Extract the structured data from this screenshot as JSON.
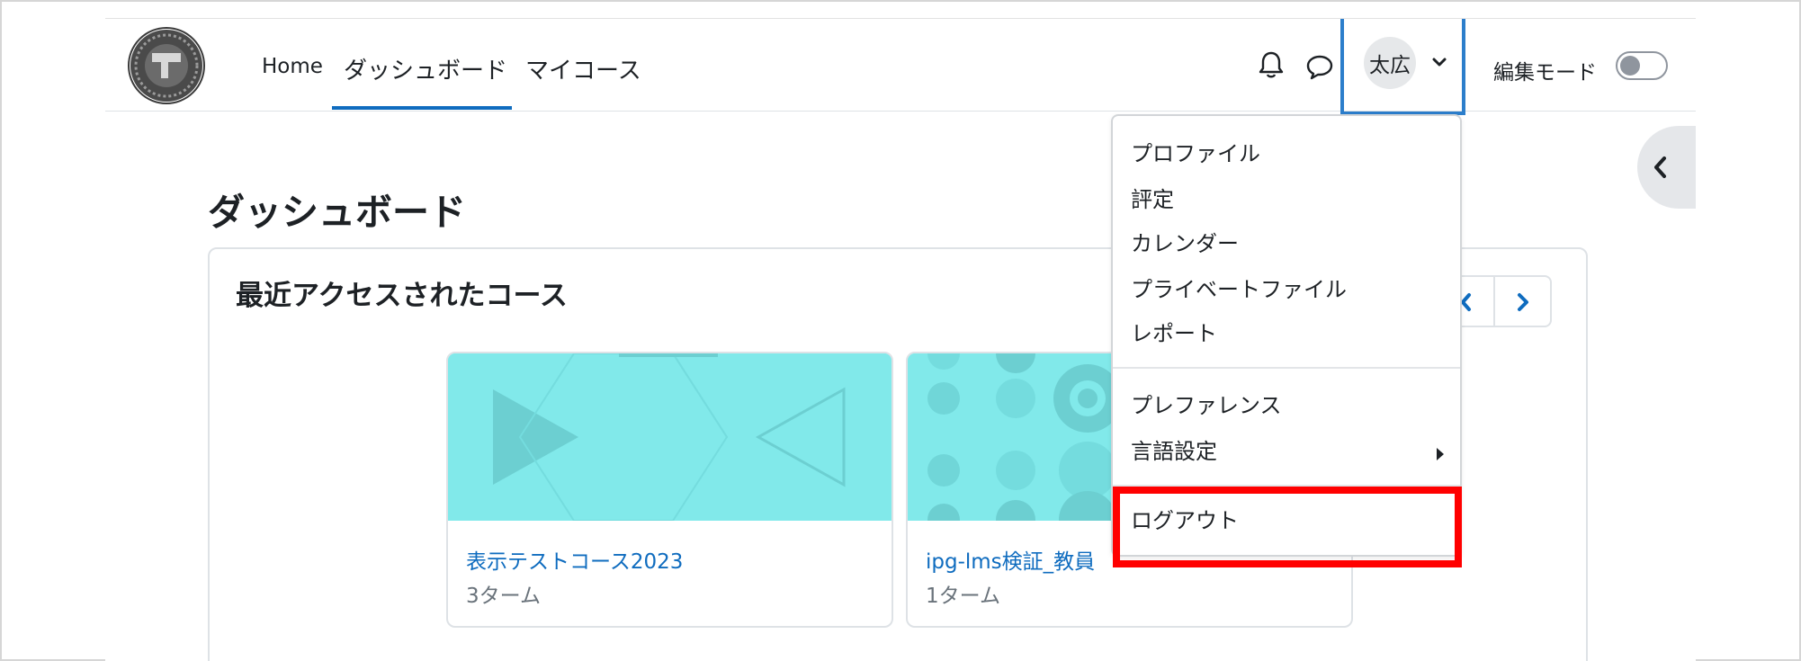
{
  "nav": {
    "home": "Home",
    "dashboard": "ダッシュボード",
    "my_courses": "マイコース"
  },
  "icons": {
    "bell": "bell-icon",
    "chat": "chat-bubble-icon",
    "caret": "chevron-down-icon",
    "drawer": "chevron-left-icon",
    "pager_prev": "chevron-left-icon",
    "pager_next": "chevron-right-icon",
    "submenu": "caret-right-icon"
  },
  "user": {
    "initials": "太広"
  },
  "edit_mode": {
    "label": "編集モード",
    "enabled": false
  },
  "main": {
    "title": "ダッシュボード",
    "block_title": "最近アクセスされたコース",
    "courses": [
      {
        "name": "表示テストコース2023",
        "category": "3ターム"
      },
      {
        "name": "ipg-lms検証_教員",
        "category": "1ターム"
      }
    ]
  },
  "user_menu": {
    "items": [
      "プロファイル",
      "評定",
      "カレンダー",
      "プライベートファイル",
      "レポート",
      "プレファレンス",
      "言語設定",
      "ログアウト"
    ]
  },
  "colors": {
    "accent": "#0f6cbf",
    "card_bg": "#81e9ea",
    "highlight": "#ff0000",
    "user_focus": "#2c7ecb"
  }
}
